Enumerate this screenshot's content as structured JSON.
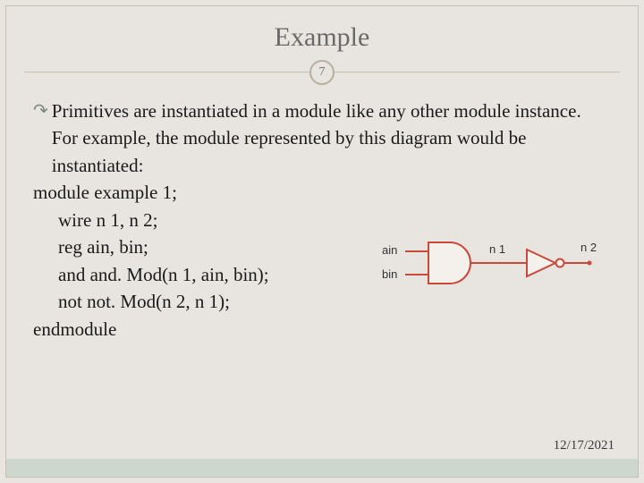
{
  "title": "Example",
  "page_number": "7",
  "bullet_text": "Primitives are instantiated in a module like any other module instance. For example, the module represented by this diagram would be instantiated:",
  "code": {
    "l1": "module example 1;",
    "l2": "wire n 1, n 2;",
    "l3": "reg ain, bin;",
    "l4": "and  and. Mod(n 1, ain, bin);",
    "l5": "not not. Mod(n 2, n 1);",
    "l6": "endmodule"
  },
  "diagram": {
    "in1": "ain",
    "in2": "bin",
    "mid": "n 1",
    "out": "n 2"
  },
  "date": "12/17/2021"
}
